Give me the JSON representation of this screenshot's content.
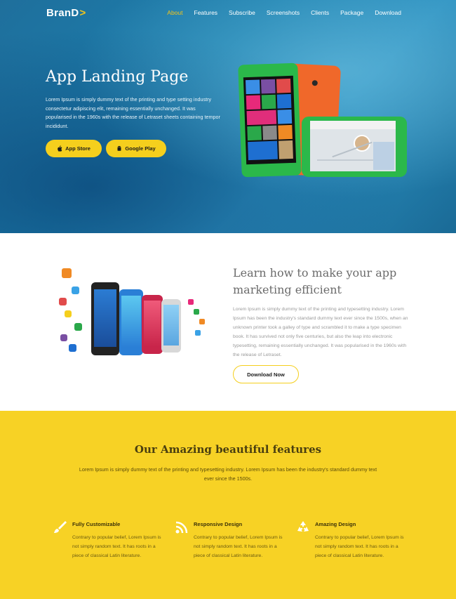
{
  "nav": {
    "brand": "BranD",
    "brand_chevron": ">",
    "items": [
      {
        "label": "About",
        "active": true
      },
      {
        "label": "Features"
      },
      {
        "label": "Subscribe"
      },
      {
        "label": "Screenshots"
      },
      {
        "label": "Clients"
      },
      {
        "label": "Package"
      },
      {
        "label": "Download"
      }
    ]
  },
  "hero": {
    "title": "App Landing Page",
    "text": "Lorem Ipsum is simply dummy text of the printing and type setting industry consectetur adipiscing elit, remaining essentially unchanged. It was popularised in the 1960s with the release of Letraset sheets containing tempor incididunt.",
    "app_store_label": "App Store",
    "google_play_label": "Google Play"
  },
  "learn": {
    "title": "Learn how to make your app marketing efficient",
    "text": "Lorem Ipsum is simply dummy text of the printing and typesetting industry. Lorem Ipsum has been the industry's standard dummy text ever since the 1500s, when an unknown printer took a galley of type and scrambled it to make a type specimen book. It has survived not only five centuries, but also the leap into electronic typesetting, remaining essentially unchanged. It was popularised in the 1960s with the release of Letraset.",
    "button_label": "Download Now"
  },
  "features": {
    "title": "Our Amazing beautiful features",
    "subtitle": "Lorem Ipsum is simply dummy text of the printing and typesetting industry. Lorem Ipsum has been the industry's standard dummy text ever since the 1500s.",
    "items": [
      {
        "name": "Fully Customizable",
        "icon": "brush-icon",
        "text": "Contrary to popular belief, Lorem Ipsum is not simply random text. It has roots in a piece of classical Latin literature."
      },
      {
        "name": "Responsive Design",
        "icon": "rss-icon",
        "text": "Contrary to popular belief, Lorem Ipsum is not simply random text. It has roots in a piece of classical Latin literature."
      },
      {
        "name": "Amazing Design",
        "icon": "recycle-icon",
        "text": "Contrary to popular belief, Lorem Ipsum is not simply random text. It has roots in a piece of classical Latin literature."
      }
    ]
  },
  "colors": {
    "accent": "#f5cf1d",
    "hero_blue": "#1b7fae",
    "features_bg": "#f7d225"
  }
}
